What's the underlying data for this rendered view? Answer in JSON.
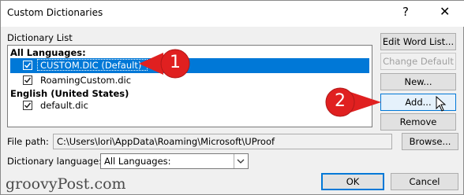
{
  "window": {
    "title": "Custom Dictionaries",
    "help_glyph": "?",
    "close_glyph": "✕"
  },
  "list": {
    "label": "Dictionary List",
    "groups": [
      {
        "name": "All Languages:",
        "items": [
          {
            "label": "CUSTOM.DIC (Default)",
            "checked": true,
            "selected": true
          },
          {
            "label": "RoamingCustom.dic",
            "checked": true,
            "selected": false
          }
        ]
      },
      {
        "name": "English (United States)",
        "items": [
          {
            "label": "default.dic",
            "checked": true,
            "selected": false
          }
        ]
      }
    ]
  },
  "buttons": {
    "edit": "Edit Word List...",
    "change_default": "Change Default",
    "new": "New...",
    "add": "Add...",
    "remove": "Remove",
    "browse": "Browse...",
    "ok": "OK",
    "cancel": "Cancel"
  },
  "file_path": {
    "label": "File path:",
    "value": "C:\\Users\\lori\\AppData\\Roaming\\Microsoft\\UProof"
  },
  "language": {
    "label": "Dictionary language:",
    "value": "All Languages:"
  },
  "callouts": [
    "1",
    "2"
  ],
  "watermark": "groovyPost.com",
  "colors": {
    "selection": "#0078d7",
    "callout": "#e02020"
  }
}
